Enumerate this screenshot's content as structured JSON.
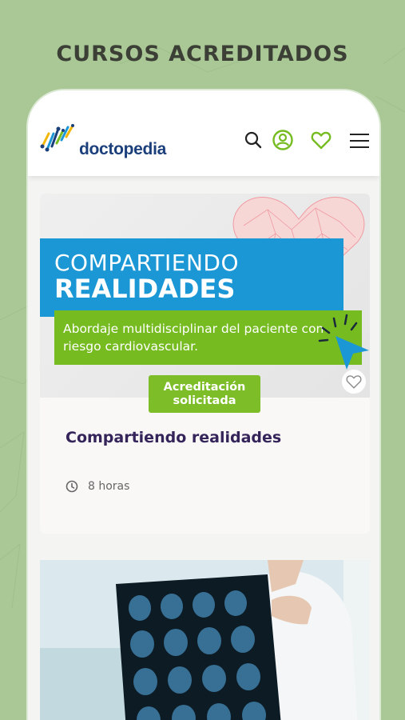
{
  "headline": "CURSOS ACREDITADOS",
  "app": {
    "logo_text": "doctopedia",
    "icons": [
      "search-icon",
      "user-account-icon",
      "heart-favorites-icon",
      "hamburger-menu-icon"
    ],
    "accent_color": "#76bc21",
    "brand_color": "#1a3f7a"
  },
  "course_card": {
    "image_title_line1": "COMPARTIENDO",
    "image_title_line2": "REALIDADES",
    "image_subtitle": "Abordaje multidisciplinar del paciente con riesgo cardiovascular.",
    "badge": "Acreditación solicitada",
    "title": "Compartiendo realidades",
    "duration": "8 horas",
    "favorite_icon": "heart-outline-icon",
    "clock_icon": "clock-icon"
  },
  "second_card": {
    "image_description_icon": "xray-doctor-image"
  }
}
